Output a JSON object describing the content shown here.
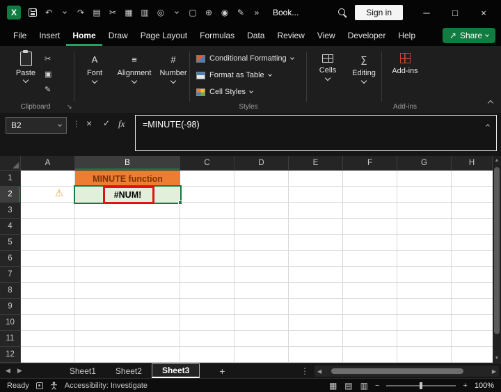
{
  "titlebar": {
    "document_title": "Book...",
    "sign_in_label": "Sign in",
    "qat": {
      "undo": "↶",
      "redo": "↷",
      "copy": "▤",
      "cut": "✂",
      "picture": "▦",
      "print": "▥",
      "touch": "◎",
      "new_file": "▢",
      "attach": "⊕",
      "camera": "◉",
      "draw": "✎",
      "more": "»"
    },
    "window": {
      "minimize": "─",
      "maximize": "□",
      "close": "×"
    }
  },
  "ribbon": {
    "tabs": [
      "File",
      "Insert",
      "Home",
      "Draw",
      "Page Layout",
      "Formulas",
      "Data",
      "Review",
      "View",
      "Developer",
      "Help"
    ],
    "active_tab": "Home",
    "share_label": "Share",
    "clipboard": {
      "paste": "Paste",
      "group": "Clipboard",
      "icons": {
        "cut": "✂",
        "copy": "▣",
        "painter": "✎"
      }
    },
    "icons": {
      "font": "A",
      "alignment": "≡",
      "number": "#",
      "editing": "∑"
    },
    "font_group": "Font",
    "alignment_group": "Alignment",
    "number_group": "Number",
    "styles": {
      "conditional_formatting": "Conditional Formatting",
      "format_as_table": "Format as Table",
      "cell_styles": "Cell Styles",
      "group": "Styles"
    },
    "cells_group": "Cells",
    "editing_group": "Editing",
    "addins": {
      "button": "Add-ins",
      "group": "Add-ins"
    }
  },
  "formula_bar": {
    "name_box": "B2",
    "cancel": "×",
    "enter": "✓",
    "fx": "fx",
    "formula": "=MINUTE(-98)"
  },
  "grid": {
    "column_headers": [
      "A",
      "B",
      "C",
      "D",
      "E",
      "F",
      "G",
      "H"
    ],
    "row_headers": [
      "1",
      "2",
      "3",
      "4",
      "5",
      "6",
      "7",
      "8",
      "9",
      "10",
      "11",
      "12"
    ],
    "cells": {
      "b1": "MINUTE function",
      "b2": "#NUM!"
    },
    "selected_cell": "B2",
    "warning_icon": "⚠"
  },
  "sheet_bar": {
    "tabs": [
      "Sheet1",
      "Sheet2",
      "Sheet3"
    ],
    "active_tab": "Sheet3",
    "add_sheet": "+"
  },
  "status_bar": {
    "ready": "Ready",
    "accessibility": "Accessibility: Investigate",
    "zoom_level": "100%"
  },
  "ui": {
    "share_arrow": "↗",
    "launcher": "↘",
    "arrow_left": "◀",
    "arrow_right": "▶",
    "arrow_up": "▲",
    "arrow_down": "▼",
    "dots_vertical": "⋮",
    "view_normal": "▦",
    "view_page_layout": "▤",
    "view_page_break": "▥",
    "minus": "−",
    "plus": "+"
  },
  "colors": {
    "excel_green": "#107C41",
    "active_tab_underline": "#21A366",
    "b1_fill": "#ED7D31",
    "b1_text": "#7E3000",
    "b2_fill": "#E2EFDA",
    "selection": "#107C41",
    "annotation_red": "#DF1515"
  }
}
